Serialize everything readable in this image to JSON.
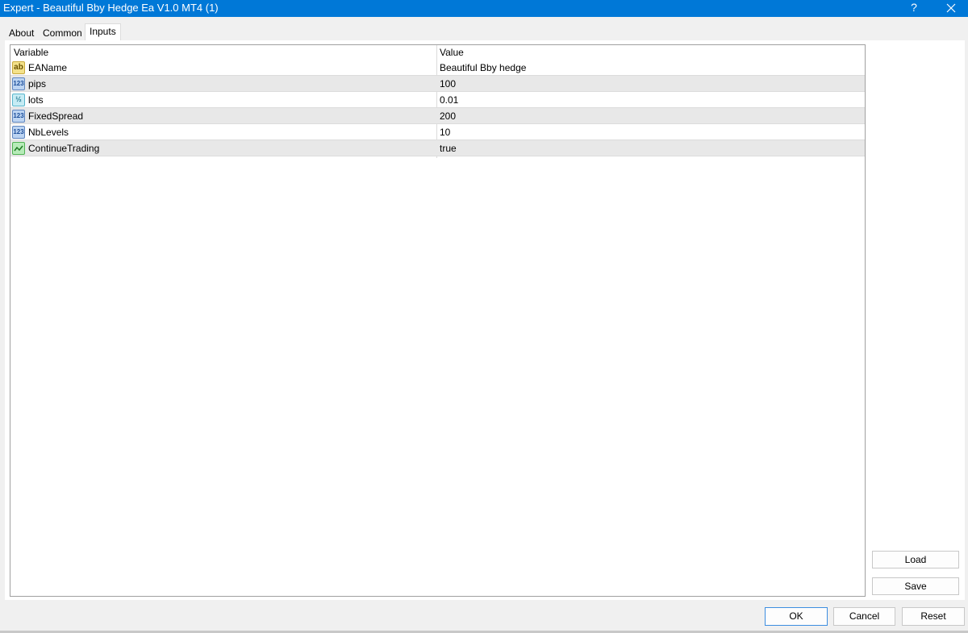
{
  "window": {
    "title": "Expert - Beautiful Bby Hedge Ea V1.0 MT4 (1)",
    "help_label": "?"
  },
  "tabs": [
    {
      "label": "About"
    },
    {
      "label": "Common"
    },
    {
      "label": "Inputs",
      "active": true
    }
  ],
  "grid": {
    "columns": [
      "Variable",
      "Value"
    ],
    "rows": [
      {
        "type_icon": "string-type-icon",
        "icon_text": "ab",
        "variable": "EAName",
        "value": "Beautiful Bby hedge"
      },
      {
        "type_icon": "integer-type-icon",
        "icon_text": "123",
        "variable": "pips",
        "value": "100"
      },
      {
        "type_icon": "double-type-icon",
        "icon_text": "½",
        "variable": "lots",
        "value": "0.01"
      },
      {
        "type_icon": "integer-type-icon",
        "icon_text": "123",
        "variable": "FixedSpread",
        "value": "200"
      },
      {
        "type_icon": "integer-type-icon",
        "icon_text": "123",
        "variable": "NbLevels",
        "value": "10"
      },
      {
        "type_icon": "boolean-type-icon",
        "icon_text": "",
        "variable": "ContinueTrading",
        "value": "true"
      }
    ]
  },
  "side_buttons": {
    "load_label": "Load",
    "save_label": "Save"
  },
  "footer_buttons": {
    "ok_label": "OK",
    "cancel_label": "Cancel",
    "reset_label": "Reset"
  },
  "colors": {
    "titlebar": "#0078d7",
    "row_alt": "#e8e8e8",
    "primary_border": "#3d8ee0"
  }
}
